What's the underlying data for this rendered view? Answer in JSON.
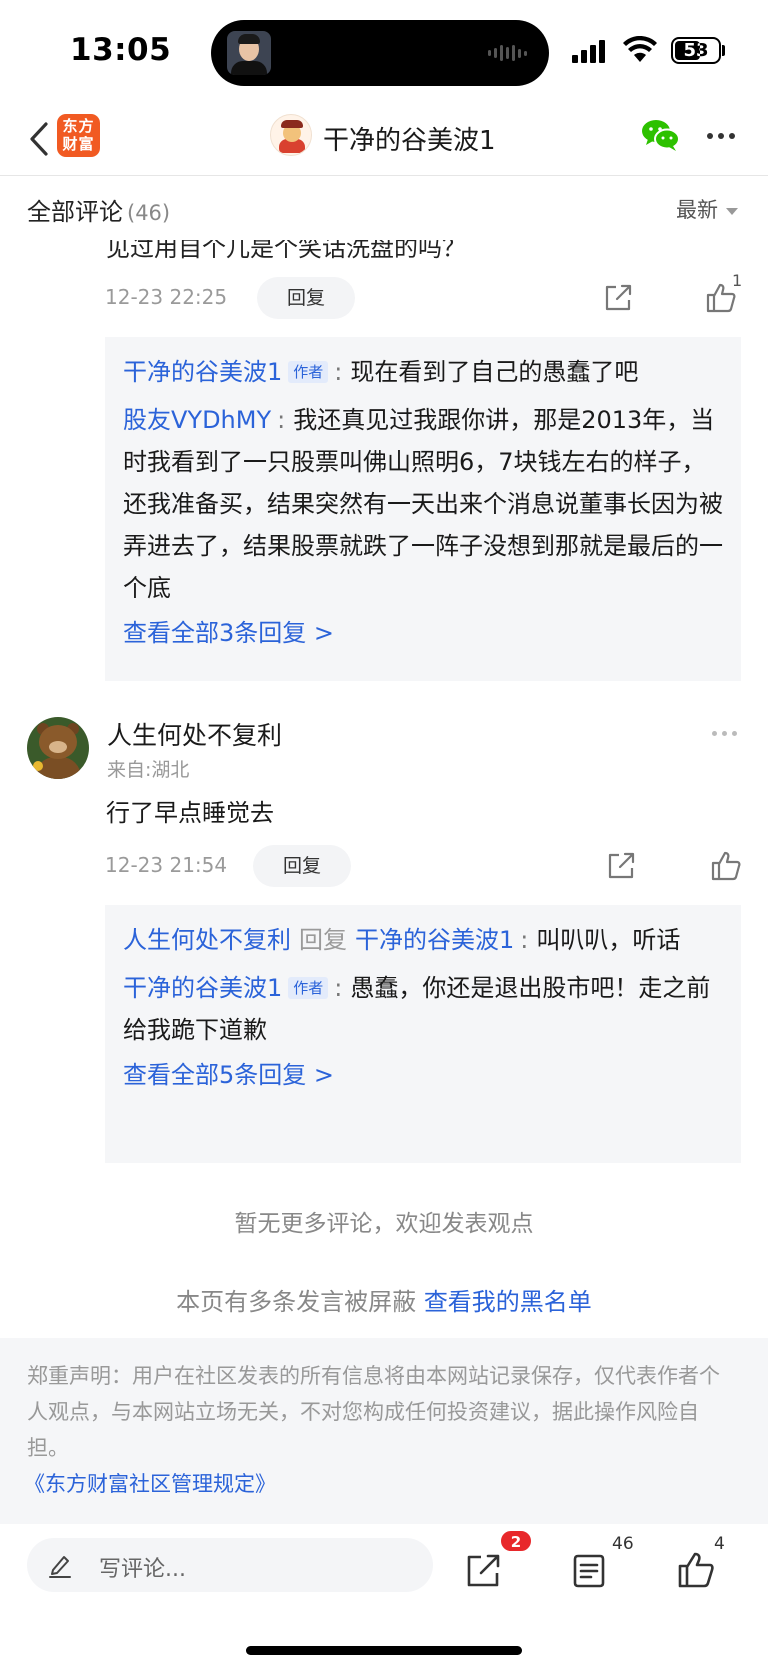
{
  "status_bar": {
    "time": "13:05",
    "battery": "53"
  },
  "nav": {
    "logo_text": "东方财富",
    "title": "干净的谷美波1"
  },
  "section": {
    "title": "全部评论",
    "count": "(46)",
    "sort": "最新"
  },
  "comment1": {
    "partial_text": "见过用自个儿是个笑话洗盘的吗？",
    "time": "12-23 22:25",
    "reply_label": "回复",
    "like_count": "1",
    "replies": [
      {
        "name": "干净的谷美波1",
        "tag": "作者",
        "text": "现在看到了自己的愚蠢了吧"
      },
      {
        "name": "股友VYDhMY",
        "text": "我还真见过我跟你讲，那是2013年，当时我看到了一只股票叫佛山照明6，7块钱左右的样子，还我准备买，结果突然有一天出来个消息说董事长因为被弄进去了，结果股票就跌了一阵子没想到那就是最后的一个底"
      }
    ],
    "view_all": "查看全部3条回复 >"
  },
  "comment2": {
    "name": "人生何处不复利",
    "location": "来自:湖北",
    "text": "行了早点睡觉去",
    "time": "12-23 21:54",
    "reply_label": "回复",
    "replies": [
      {
        "name": "人生何处不复利",
        "reply_word": "回复",
        "target": "干净的谷美波1",
        "text": "叫叭叭，听话"
      },
      {
        "name": "干净的谷美波1",
        "tag": "作者",
        "text": "愚蠢，你还是退出股市吧！走之前给我跪下道歉"
      }
    ],
    "view_all": "查看全部5条回复 >"
  },
  "footer": {
    "no_more": "暂无更多评论，欢迎发表观点",
    "blocked_text": "本页有多条发言被屏蔽",
    "blocked_link": "查看我的黑名单",
    "disclaimer": "郑重声明：用户在社区发表的所有信息将由本网站记录保存，仅代表作者个人观点，与本网站立场无关，不对您构成任何投资建议，据此操作风险自担。",
    "rules_link": "《东方财富社区管理规定》"
  },
  "bottom_bar": {
    "placeholder": "写评论...",
    "share_badge": "2",
    "comment_count": "46",
    "like_count": "4"
  },
  "colors": {
    "link_blue": "#2b63d9",
    "brand_orange": "#f15a22",
    "badge_red": "#e8282b",
    "wechat_green": "#2dc100"
  },
  "icons": [
    "back-icon",
    "wechat-icon",
    "more-icon",
    "share-icon",
    "like-icon",
    "pen-icon",
    "comment-list-icon"
  ]
}
